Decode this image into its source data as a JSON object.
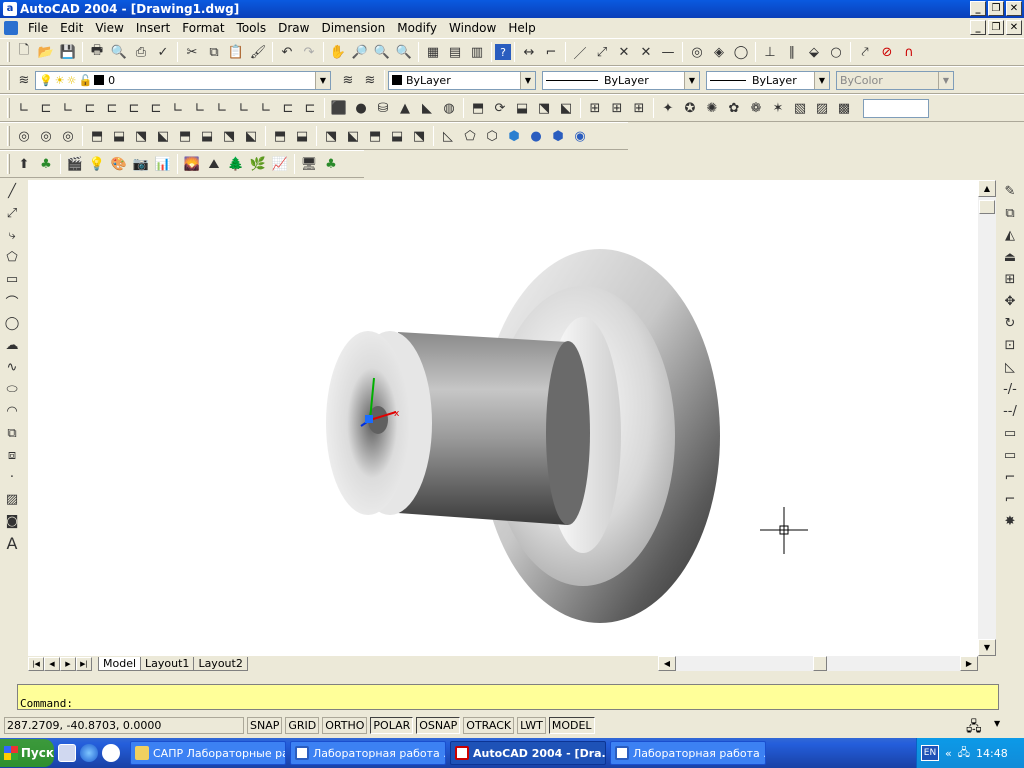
{
  "window": {
    "title": "AutoCAD 2004 - [Drawing1.dwg]",
    "app_icon": "a"
  },
  "menu": [
    "File",
    "Edit",
    "View",
    "Insert",
    "Format",
    "Tools",
    "Draw",
    "Dimension",
    "Modify",
    "Window",
    "Help"
  ],
  "layer_toolbar": {
    "layer_value": "0",
    "color_value": "ByLayer",
    "linetype_value": "ByLayer",
    "lineweight_value": "ByLayer",
    "plotstyle_value": "ByColor"
  },
  "tabs": [
    {
      "label": "Model",
      "active": true
    },
    {
      "label": "Layout1",
      "active": false
    },
    {
      "label": "Layout2",
      "active": false
    }
  ],
  "command": {
    "prompt": "Command:"
  },
  "status": {
    "coordinates": "287.2709, -40.8703, 0.0000",
    "buttons": [
      "SNAP",
      "GRID",
      "ORTHO",
      "POLAR",
      "OSNAP",
      "OTRACK",
      "LWT",
      "MODEL"
    ],
    "active_buttons": [
      "POLAR",
      "OSNAP",
      "MODEL"
    ]
  },
  "taskbar": {
    "start_label": "Пуск",
    "tasks": [
      {
        "label": "САПР Лабораторные ра...",
        "active": false,
        "icon": "folder-icon"
      },
      {
        "label": "Лабораторная работа ...",
        "active": false,
        "icon": "word-icon"
      },
      {
        "label": "AutoCAD 2004 - [Dra...",
        "active": true,
        "icon": "autocad-icon"
      },
      {
        "label": "Лабораторная работа ...",
        "active": false,
        "icon": "word-icon"
      }
    ],
    "lang": "EN",
    "clock": "14:48"
  },
  "colors": {
    "titlebar": "#0a4ad0",
    "cmdline": "#ffff99",
    "taskbar": "#245edb"
  }
}
